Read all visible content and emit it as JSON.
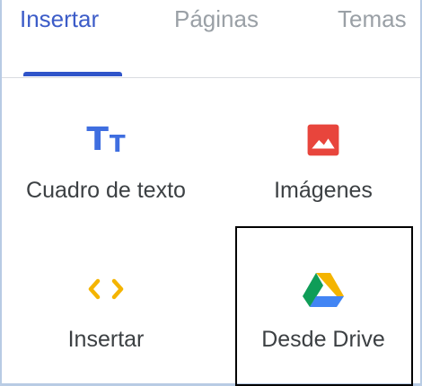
{
  "tabs": [
    {
      "label": "Insertar",
      "active": true
    },
    {
      "label": "Páginas",
      "active": false
    },
    {
      "label": "Temas",
      "active": false
    }
  ],
  "insert_items": [
    {
      "label": "Cuadro de texto",
      "icon": "text-box-icon"
    },
    {
      "label": "Imágenes",
      "icon": "image-icon"
    },
    {
      "label": "Insertar",
      "icon": "embed-code-icon"
    },
    {
      "label": "Desde Drive",
      "icon": "google-drive-icon"
    }
  ],
  "colors": {
    "accent": "#2f54c9",
    "text_icon": "#3f6ee0",
    "image_icon": "#e8453c",
    "embed_icon": "#f4b400",
    "drive_green": "#0f9d58",
    "drive_yellow": "#f4b400",
    "drive_blue": "#4285f4"
  }
}
